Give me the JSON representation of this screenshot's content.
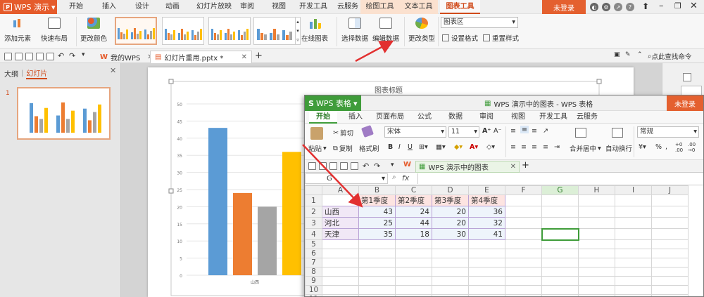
{
  "app": {
    "name": "WPS 演示",
    "login": "未登录"
  },
  "menu_tabs": [
    "开始",
    "插入",
    "设计",
    "动画",
    "幻灯片放映",
    "审阅",
    "视图",
    "开发工具",
    "云服务",
    "绘图工具",
    "文本工具",
    "图表工具"
  ],
  "ribbon": {
    "add_element": "添加元素",
    "quick_layout": "快速布局",
    "change_color": "更改颜色",
    "online_chart": "在线图表",
    "select_data": "选择数据",
    "edit_data": "编辑数据",
    "change_type": "更改类型",
    "chart_area_select": "图表区",
    "set_format": "设置格式",
    "reset_style": "重置样式"
  },
  "quickbar": {
    "tab_mywps": "我的WPS",
    "tab_doc": "幻灯片重用.pptx *",
    "search": "点此查找命令"
  },
  "left_pane": {
    "tab_outline": "大纲",
    "tab_slides": "幻灯片",
    "slide_number": "1"
  },
  "slide_chart": {
    "title": "图表标题",
    "y_ticks": [
      "50",
      "45",
      "40",
      "35",
      "30",
      "25",
      "20",
      "15",
      "10",
      "5",
      "0"
    ],
    "category": "山西"
  },
  "chart_data": {
    "type": "bar",
    "title": "图表标题",
    "categories": [
      "山西",
      "河北",
      "天津"
    ],
    "series": [
      {
        "name": "第1季度",
        "values": [
          43,
          25,
          35
        ]
      },
      {
        "name": "第2季度",
        "values": [
          24,
          44,
          18
        ]
      },
      {
        "name": "第3季度",
        "values": [
          20,
          20,
          30
        ]
      },
      {
        "name": "第4季度",
        "values": [
          36,
          32,
          41
        ]
      }
    ],
    "ylim": [
      0,
      50
    ],
    "colors": [
      "#5b9bd5",
      "#ed7d31",
      "#a5a5a5",
      "#ffc000"
    ]
  },
  "spreadsheet": {
    "app": "WPS 表格",
    "title": "WPS 演示中的图表 - WPS 表格",
    "login": "未登录",
    "tabs": [
      "开始",
      "插入",
      "页面布局",
      "公式",
      "数据",
      "审阅",
      "视图",
      "开发工具",
      "云服务"
    ],
    "ribbon": {
      "paste": "粘贴",
      "cut": "剪切",
      "copy": "复制",
      "format_painter": "格式刷",
      "font": "宋体",
      "font_size": "11",
      "merge_center": "合并居中",
      "wrap_text": "自动换行",
      "number_format": "常规"
    },
    "doc_tab": "WPS 演示中的图表",
    "name_box": "G",
    "fx": "fx",
    "columns": [
      "A",
      "B",
      "C",
      "D",
      "E",
      "F",
      "G",
      "H",
      "I",
      "J"
    ],
    "rows": [
      [
        "",
        "第1季度",
        "第2季度",
        "第3季度",
        "第4季度",
        "",
        "",
        "",
        "",
        ""
      ],
      [
        "山西",
        "43",
        "24",
        "20",
        "36",
        "",
        "",
        "",
        "",
        ""
      ],
      [
        "河北",
        "25",
        "44",
        "20",
        "32",
        "",
        "",
        "",
        "",
        ""
      ],
      [
        "天津",
        "35",
        "18",
        "30",
        "41",
        "",
        "",
        "",
        "",
        ""
      ],
      [
        "",
        "",
        "",
        "",
        "",
        "",
        "",
        "",
        "",
        ""
      ],
      [
        "",
        "",
        "",
        "",
        "",
        "",
        "",
        "",
        "",
        ""
      ],
      [
        "",
        "",
        "",
        "",
        "",
        "",
        "",
        "",
        "",
        ""
      ],
      [
        "",
        "",
        "",
        "",
        "",
        "",
        "",
        "",
        "",
        ""
      ],
      [
        "",
        "",
        "",
        "",
        "",
        "",
        "",
        "",
        "",
        ""
      ],
      [
        "",
        "",
        "",
        "",
        "",
        "",
        "",
        "",
        "",
        ""
      ],
      [
        "",
        "",
        "",
        "",
        "",
        "",
        "",
        "",
        "",
        ""
      ]
    ],
    "row_numbers": [
      "1",
      "2",
      "3",
      "4",
      "5",
      "6",
      "7",
      "8",
      "9",
      "10",
      "11"
    ]
  }
}
